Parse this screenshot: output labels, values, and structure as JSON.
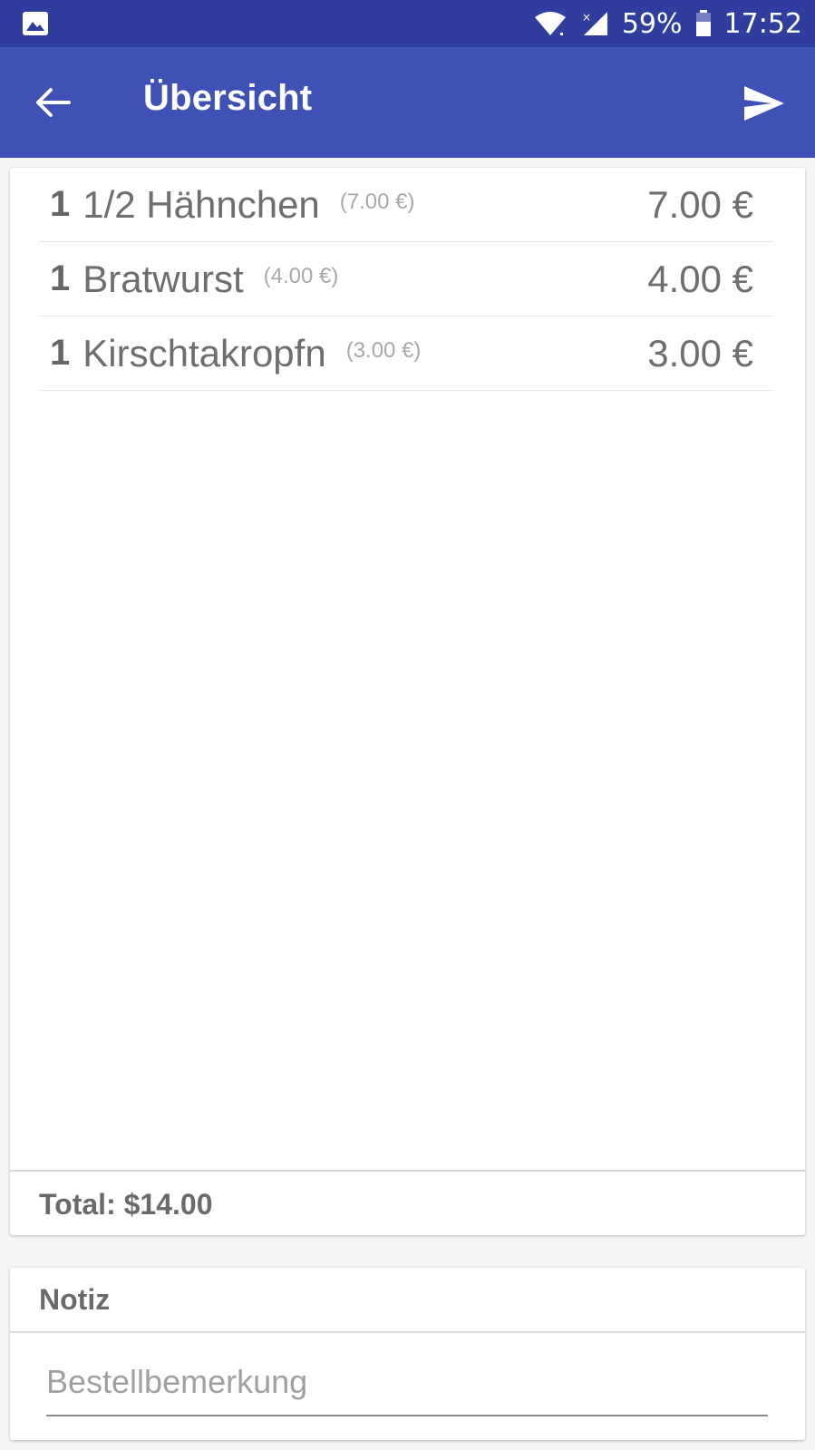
{
  "status_bar": {
    "battery": "59%",
    "time": "17:52"
  },
  "app_bar": {
    "title": "Übersicht"
  },
  "order": {
    "items": [
      {
        "qty": "1",
        "name": "1/2 Hähnchen",
        "unit_price": "(7.00 €)",
        "price": "7.00 €"
      },
      {
        "qty": "1",
        "name": "Bratwurst",
        "unit_price": "(4.00 €)",
        "price": "4.00 €"
      },
      {
        "qty": "1",
        "name": "Kirschtakropfn",
        "unit_price": "(3.00 €)",
        "price": "3.00 €"
      }
    ],
    "total": "Total: $14.00"
  },
  "notes": {
    "title": "Notiz",
    "placeholder": "Bestellbemerkung",
    "value": ""
  },
  "colors": {
    "status_bar": "#2f3d9e",
    "app_bar": "#3f51b5",
    "background": "#f5f5f5",
    "card": "#ffffff"
  },
  "icons": {
    "status_left": "image-icon",
    "wifi": "wifi-icon",
    "signal": "cell-signal-icon",
    "battery": "battery-icon",
    "back": "arrow-back-icon",
    "send": "send-icon"
  }
}
